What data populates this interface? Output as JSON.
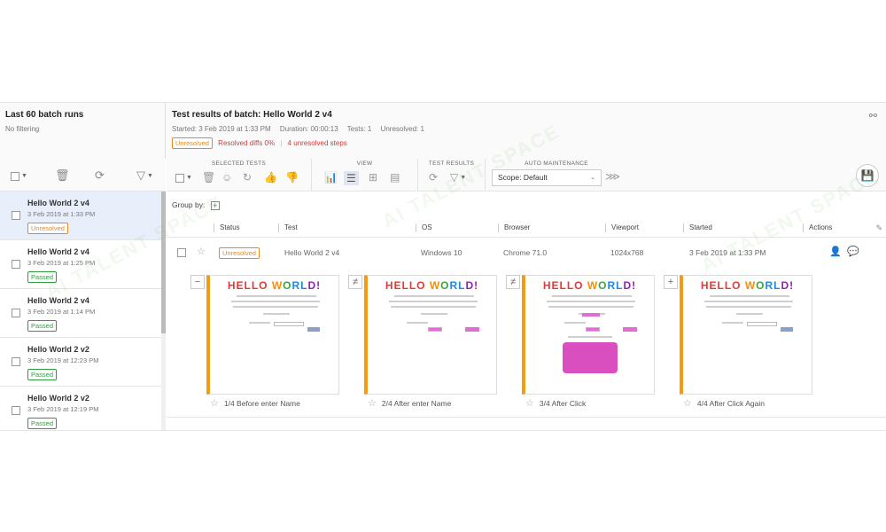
{
  "left": {
    "title": "Last 60 batch runs",
    "filter": "No filtering",
    "batches": [
      {
        "name": "Hello World 2 v4",
        "date": "3 Feb 2019 at 1:33 PM",
        "status": "Unresolved",
        "selected": true
      },
      {
        "name": "Hello World 2 v4",
        "date": "3 Feb 2019 at 1:25 PM",
        "status": "Passed",
        "selected": false
      },
      {
        "name": "Hello World 2 v4",
        "date": "3 Feb 2019 at 1:14 PM",
        "status": "Passed",
        "selected": false
      },
      {
        "name": "Hello World 2 v2",
        "date": "3 Feb 2019 at 12:23 PM",
        "status": "Passed",
        "selected": false
      },
      {
        "name": "Hello World 2 v2",
        "date": "3 Feb 2019 at 12:19 PM",
        "status": "Passed",
        "selected": false
      }
    ]
  },
  "header": {
    "title": "Test results of batch: Hello World 2 v4",
    "started": "Started: 3 Feb 2019 at 1:33 PM",
    "duration": "Duration: 00:00:13",
    "tests": "Tests: 1",
    "unresolved": "Unresolved: 1",
    "status_badge": "Unresolved",
    "resolved_diffs": "Resolved diffs 0%",
    "unresolved_steps": "4 unresolved steps"
  },
  "toolbar": {
    "selected_tests": "SELECTED TESTS",
    "view": "VIEW",
    "test_results": "TEST RESULTS",
    "auto_maintenance": "AUTO MAINTENANCE",
    "scope": "Scope: Default"
  },
  "group_by": "Group by:",
  "columns": [
    "Status",
    "Test",
    "OS",
    "Browser",
    "Viewport",
    "Started",
    "Actions"
  ],
  "row": {
    "status": "Unresolved",
    "test": "Hello World 2 v4",
    "os": "Windows 10",
    "browser": "Chrome 71.0",
    "viewport": "1024x768",
    "started": "3 Feb 2019 at 1:33 PM"
  },
  "steps": [
    {
      "mark": "−",
      "caption": "1/4 Before enter Name"
    },
    {
      "mark": "≠",
      "caption": "2/4 After enter Name"
    },
    {
      "mark": "≠",
      "caption": "3/4 After Click"
    },
    {
      "mark": "+",
      "caption": "4/4 After Click Again"
    }
  ],
  "screenshot_text": {
    "hello_1": "HELLO ",
    "hello_2": "W",
    "hello_3": "O",
    "hello_4": "RL",
    "hello_5": "D!"
  },
  "watermark": "AI TALENT SPACE",
  "colors": {
    "accent_orange": "#f39c12",
    "unresolved": "#e88a1a",
    "passed": "#2e9d3f",
    "red": "#d23b3b",
    "selected_bg": "#e8effa"
  }
}
